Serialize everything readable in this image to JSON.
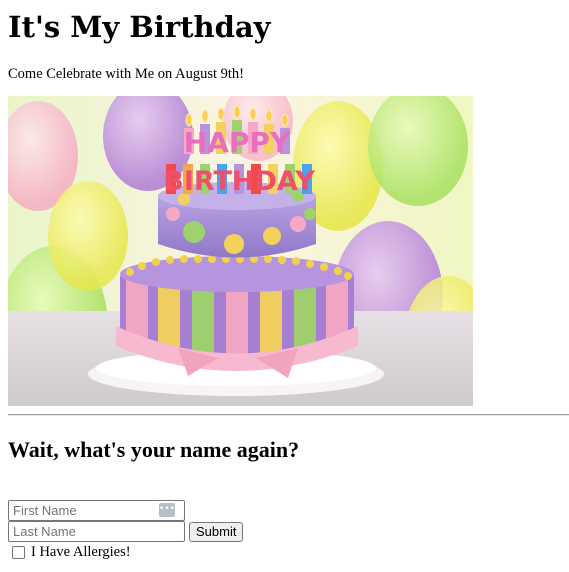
{
  "header": {
    "title": "It's My Birthday",
    "subtitle": "Come Celebrate with Me on August 9th!"
  },
  "hero_image": {
    "icon": "birthday-cake-image",
    "cake_lettering_top": "HAPPY",
    "cake_lettering_bottom": "BIRTHDAY"
  },
  "section": {
    "heading": "Wait, what's your name again?"
  },
  "form": {
    "first_name": {
      "placeholder": "First Name",
      "value": ""
    },
    "autofill_icon": "autofill-icon",
    "last_name": {
      "placeholder": "Last Name",
      "value": ""
    },
    "submit_label": "Submit",
    "allergies": {
      "label": "I Have Allergies!",
      "checked": false
    }
  }
}
